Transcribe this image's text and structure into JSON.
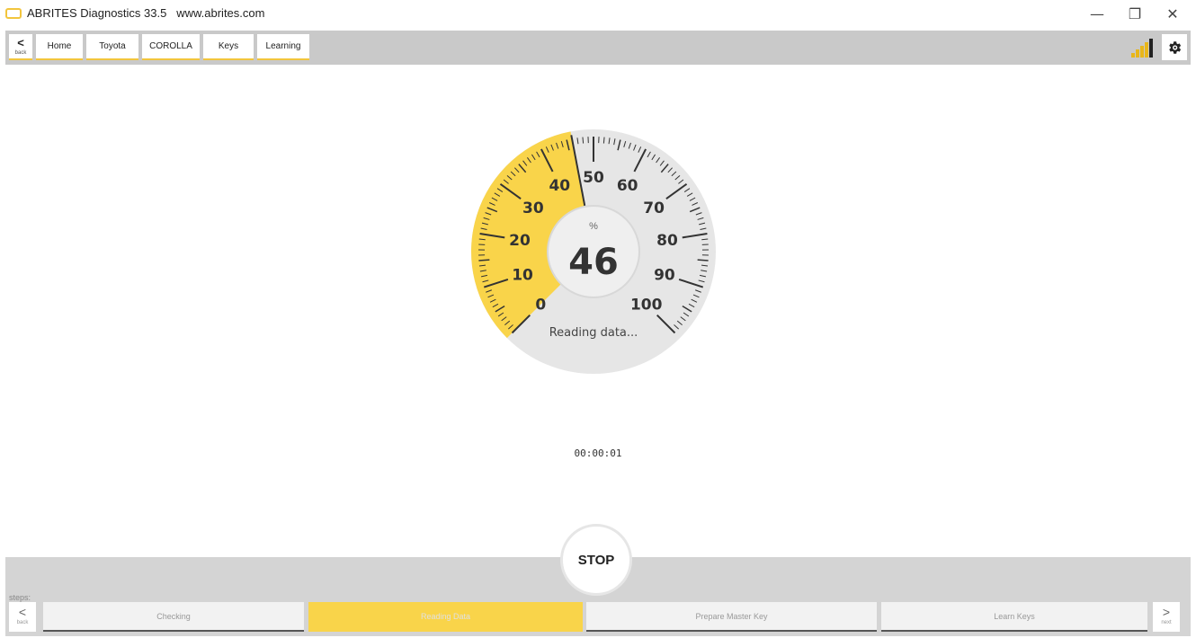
{
  "window": {
    "title": "ABRITES Diagnostics 33.5",
    "url": "www.abrites.com",
    "minimize": "—",
    "restore": "❐",
    "close": "✕"
  },
  "toolbar": {
    "back_label": "back",
    "breadcrumbs": [
      "Home",
      "Toyota",
      "COROLLA",
      "Keys",
      "Learning"
    ]
  },
  "gauge": {
    "value": "46",
    "value_number": 46,
    "unit": "%",
    "status": "Reading data...",
    "ticks": [
      "0",
      "10",
      "20",
      "30",
      "40",
      "50",
      "60",
      "70",
      "80",
      "90",
      "100"
    ],
    "fill_color": "#f9d44a"
  },
  "timer": "00:00:01",
  "stop_label": "STOP",
  "steps": {
    "label": "steps:",
    "back_label": "back",
    "next_label": "next",
    "items": [
      "Checking",
      "Reading Data",
      "Prepare Master Key",
      "Learn Keys"
    ],
    "active_index": 1
  },
  "icons": {
    "back": "chevron-left-icon",
    "next": "chevron-right-icon",
    "signal": "signal-strength-icon",
    "settings": "gear-icon"
  }
}
